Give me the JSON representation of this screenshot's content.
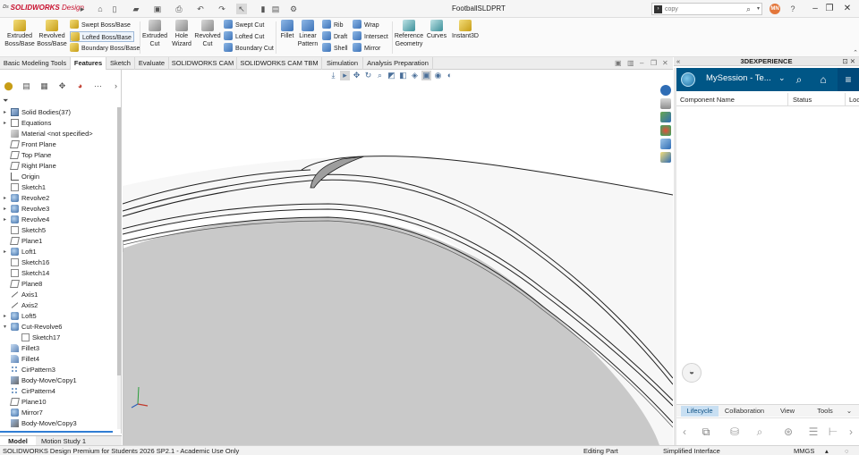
{
  "app": {
    "brand": "SOLIDWORKS",
    "brand_suffix": "Design",
    "document_title": "FootballSLDPRT"
  },
  "search": {
    "value": "",
    "placeholder": "copy"
  },
  "user": {
    "initials": "MN"
  },
  "commands": {
    "extruded_boss": "Extruded Boss/Base",
    "revolved_boss": "Revolved Boss/Base",
    "swept_boss": "Swept Boss/Base",
    "lofted_boss": "Lofted Boss/Base",
    "boundary_boss": "Boundary Boss/Base",
    "extruded_cut": "Extruded Cut",
    "hole_wizard": "Hole Wizard",
    "revolved_cut": "Revolved Cut",
    "swept_cut": "Swept Cut",
    "lofted_cut": "Lofted Cut",
    "boundary_cut": "Boundary Cut",
    "fillet": "Fillet",
    "linear_pattern": "Linear Pattern",
    "rib": "Rib",
    "draft": "Draft",
    "shell": "Shell",
    "wrap": "Wrap",
    "intersect": "Intersect",
    "mirror": "Mirror",
    "reference_geometry": "Reference Geometry",
    "curves": "Curves",
    "instant3d": "Instant3D"
  },
  "tabs": [
    "Basic Modeling Tools",
    "Features",
    "Sketch",
    "Evaluate",
    "SOLIDWORKS CAM",
    "SOLIDWORKS CAM TBM",
    "Simulation",
    "Analysis Preparation"
  ],
  "active_tab": "Features",
  "feature_tree": [
    "Solid Bodies(37)",
    "Equations",
    "Material <not specified>",
    "Front Plane",
    "Top Plane",
    "Right Plane",
    "Origin",
    "Sketch1",
    "Revolve2",
    "Revolve3",
    "Revolve4",
    "Sketch5",
    "Plane1",
    "Loft1",
    "Sketch16",
    "Sketch14",
    "Plane8",
    "Axis1",
    "Axis2",
    "Loft5",
    "Cut-Revolve6",
    "Sketch17",
    "Fillet3",
    "Fillet4",
    "CirPattern3",
    "Body-Move/Copy1",
    "CirPattern4",
    "Plane10",
    "Mirror7",
    "Body-Move/Copy3"
  ],
  "bottom_tabs": {
    "model": "Model",
    "motion": "Motion Study 1"
  },
  "status": {
    "product": "SOLIDWORKS Design Premium for Students 2026 SP2.1 - Academic Use Only",
    "mode": "Editing Part",
    "interface": "Simplified Interface",
    "units": "MMGS"
  },
  "experience": {
    "header": "3DEXPERIENCE",
    "session": "MySession - Te...",
    "columns": {
      "name": "Component Name",
      "status": "Status",
      "location": "Loc"
    },
    "tabs": [
      "Lifecycle",
      "Collaboration",
      "View",
      "Tools"
    ],
    "active_tab": "Lifecycle"
  },
  "colors": {
    "accent": "#2f7dd3",
    "experience_bar": "#005686",
    "model_shade": "#c9c9c9",
    "brand_red": "#c8102e"
  }
}
